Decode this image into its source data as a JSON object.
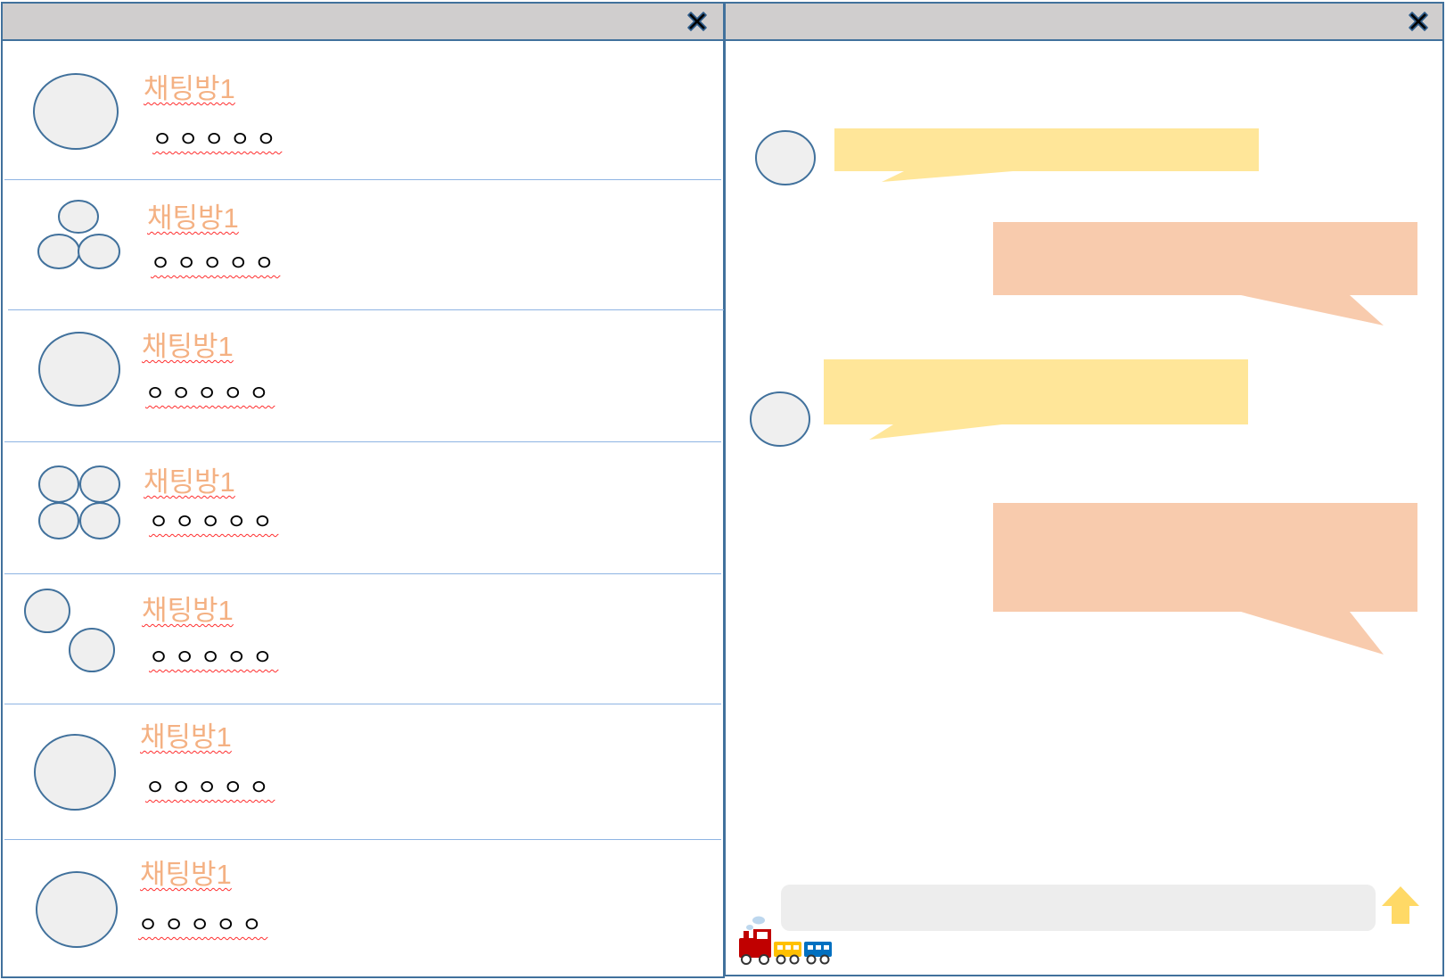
{
  "room_list": {
    "rooms": [
      {
        "name": "채팅방1",
        "preview": "ㅇㅇㅇㅇㅇ",
        "avatar": "single-avatar-icon"
      },
      {
        "name": "채팅방1",
        "preview": "ㅇㅇㅇㅇㅇ",
        "avatar": "group-of-three-avatar-icon"
      },
      {
        "name": "채팅방1",
        "preview": "ㅇㅇㅇㅇㅇ",
        "avatar": "single-avatar-icon"
      },
      {
        "name": "채팅방1",
        "preview": "ㅇㅇㅇㅇㅇ",
        "avatar": "group-of-four-avatar-icon"
      },
      {
        "name": "채팅방1",
        "preview": "ㅇㅇㅇㅇㅇ",
        "avatar": "group-of-two-avatar-icon"
      },
      {
        "name": "채팅방1",
        "preview": "ㅇㅇㅇㅇㅇ",
        "avatar": "single-avatar-icon"
      },
      {
        "name": "채팅방1",
        "preview": "ㅇㅇㅇㅇㅇ",
        "avatar": "single-avatar-icon"
      }
    ]
  },
  "chat": {
    "messages": [
      {
        "side": "received",
        "text": ""
      },
      {
        "side": "sent",
        "text": ""
      },
      {
        "side": "received",
        "text": ""
      },
      {
        "side": "sent",
        "text": ""
      }
    ],
    "input": {
      "value": "",
      "placeholder": ""
    }
  },
  "icons": {
    "close": "close-icon",
    "send": "up-arrow-icon",
    "decoration": "train-icon"
  },
  "colors": {
    "titlebar": "#d0cece",
    "border": "#41719c",
    "room_name": "#f4b183",
    "received_bubble": "#ffe699",
    "sent_bubble": "#f8cbad",
    "avatar_fill": "#efefef",
    "input_bg": "#ededed",
    "send_arrow": "#ffd966"
  }
}
